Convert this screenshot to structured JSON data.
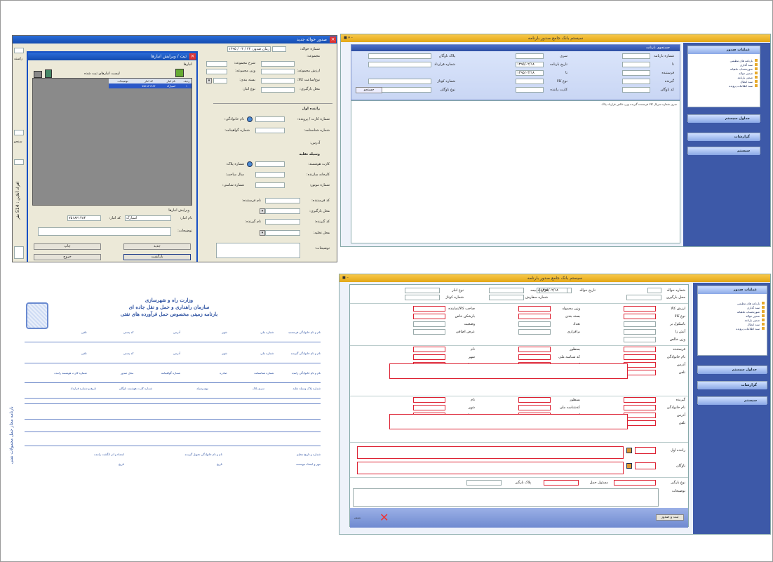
{
  "w1": {
    "title": "صدور حواله جدید",
    "f": {
      "no": "شماره حواله:",
      "date": "زمان صدور: ۲۳ / ۰۳ / ۱۳۹۵",
      "grp": "مجموعه:",
      "desc": "شرح مجموعه:",
      "val": "ارزش مجموعه:",
      "wt": "وزن مجموعه:",
      "pkg": "نوع/ساعت کالا:",
      "pkgtype": "بسته بندی:",
      "load": "محل بارگیری:",
      "tp": "نوع انبار:"
    },
    "r": {
      "head": "راننده اول",
      "card": "شماره کارت / پرونده:",
      "name": "نام خانوادگی:",
      "id": "شماره شناسنامه:",
      "cert": "شماره گواهینامه:",
      "addr": "آدرس:"
    },
    "v": {
      "head": "وسیله نقلیه",
      "card": "کارت هوشمند:",
      "plate": "شماره پلاک:",
      "factory": "کارخانه سازنده:",
      "year": "سال ساخت:",
      "motor": "شماره موتور:",
      "chassis": "شماره شاسی:"
    },
    "b": {
      "sender": "کد فرستنده:",
      "sname": "نام فرستنده:",
      "load": "محل بارگیری:",
      "recv": "کد گیرنده:",
      "rname": "نام گیرنده:",
      "unload": "محل تخلیه:",
      "notes": "توضیحات:"
    },
    "left": {
      "r1": "کد",
      "r2": "راسته",
      "r3": "سنجو"
    }
  },
  "dlg": {
    "title": "ثبت / ویرایش انبارها",
    "grp": "انبارها",
    "list": "لیست انبارهای ثبت شده",
    "cols": [
      "ردیف",
      "نام انبار",
      "کد انبار",
      "توضیحات"
    ],
    "row": [
      "۱",
      "اسپارک",
      "۷۵۱۸۲۱۴۸۴",
      ""
    ],
    "edit": "ویرایش انبارها",
    "nm": "نام انبار:",
    "nmv": "اسپارک",
    "cd": "کد انبار:",
    "cdv": "۷۵۱۸۲۱۴۸۴",
    "desc": "توضیحات:",
    "ba": "جدید",
    "bb": "چاپ",
    "bc": "بازگشت",
    "bd": "خروج",
    "side": "افراد آنلاین : 514 نفر"
  },
  "w2": {
    "title": "سیستم بانک جامع صدور بارنامه",
    "panel": "جستجوی بارنامه",
    "l": [
      "شماره بارنامه",
      "تا",
      "سری",
      "تاریخ بارنامه",
      "تا",
      "پلاک ناوگان",
      "فرستنده",
      "شماره قرارداد",
      "گیرنده",
      "نوع کالا",
      "شماره کوتاژ",
      "کد ناوگان",
      "کارت راننده",
      "نوع ناوگان"
    ],
    "f": [
      "",
      "",
      "",
      "۱۳۹۵/۰۲/۱۸",
      "۱۳۹۵/۰۳/۱۸",
      "",
      "",
      "",
      "",
      "",
      "",
      "",
      "",
      ""
    ],
    "sbtn": "جستجو",
    "cols": "سری  شماره  سریال  کالا  فرستنده  گیرنده  وزن خالص  قرارداد  پلاک",
    "side": {
      "h1": "عملیات صدور",
      "items": [
        "بارنامه های تنظیمی",
        "سند گذاری",
        "صورتحساب ماهیانه",
        "صدور حواله",
        "صدور بارنامه",
        "سند ابطال",
        "سند اطلاعات پرونده"
      ],
      "h2": "جداول سیستم",
      "h3": "گزارشات",
      "h4": "سیستم"
    }
  },
  "doc": {
    "t1": "وزارت راه و شهرسازی",
    "t2": "سازمان راهداری و حمل و نقل جاده ای",
    "t3": "بارنامه زمینی مخصوص حمل فرآورده های نفتی",
    "side": "بارنامه مجاز حمل محمولات نفتی",
    "r1": [
      "نام و نام خانوادگی فرستنده",
      "شماره ملی",
      "شهر",
      "آدرس",
      "کد پستی",
      "تلفن"
    ],
    "r2": [
      "نام و نام خانوادگی گیرنده",
      "شماره ملی",
      "شهر",
      "آدرس",
      "کد پستی",
      "تلفن"
    ],
    "r3": [
      "نام و نام خانوادگی راننده",
      "شماره شناسنامه",
      "صادره",
      "شماره گواهینامه",
      "محل صدور",
      "شماره کارت هوشمند راننده"
    ],
    "r4": [
      "شماره پلاک وسیله نقلیه",
      "سری پلاک",
      "نوع وسیله",
      "شماره کارت هوشمند ناوگان",
      "تاریخ و شماره قرارداد"
    ],
    "bot": [
      "شماره و تاریخ تنظیم",
      "نام و نام خانوادگی تحویل گیرنده",
      "امضاء و اثر انگشت راننده",
      "مهر و امضاء موسسه",
      "تاریخ",
      "تاریخ"
    ]
  },
  "w3": {
    "title": "سیستم بانک جامع صدور بارنامه",
    "top": [
      "شماره حواله",
      "تاریخ حواله",
      "۱۳۹۵/۰۲/۱۸",
      "قرارداد بیمه",
      "نوع انبار",
      "محل بارگیری",
      "شماره سفارش",
      "شماره کوتاژ"
    ],
    "g": [
      "ارزش کالا",
      "وزن محموله",
      "صاحب کالا/نماینده",
      "نوع کالا",
      "بسته بندی",
      "بارشکن خاص",
      "باسکول بر",
      "تعداد",
      "وضعیت",
      "آتش زا",
      "برافزاری",
      "عرض اضافی",
      "وزن خالص"
    ],
    "snd": [
      "فرستنده",
      "بمنظور",
      "نام",
      "نام خانوادگی",
      "کد شناسه ملی",
      "شهر",
      "آدرس",
      "کد پستی",
      "همراه",
      "تلفن",
      "دورنگار",
      "انبار"
    ],
    "rcv": [
      "گیرنده",
      "بمنظور",
      "نام",
      "نام خانوادگی",
      "کدشناسه ملی",
      "شهر",
      "آدرس",
      "کد پستی",
      "همراه",
      "تلفن",
      "دورنگار",
      "انبار"
    ],
    "drv": [
      "راننده اول",
      "ناوگان"
    ],
    "btm": [
      "نوع بارگیر",
      "مسئول حمل",
      "پلاک بارگیر",
      "توضیحات"
    ],
    "save": "ثبت و صدور",
    "close": "بستن",
    "side": {
      "h1": "عملیات صدور",
      "items": [
        "بارنامه های تنظیمی",
        "سند گذاری",
        "صورتحساب ماهیانه",
        "صدور حواله",
        "صدور بارنامه",
        "سند ابطال",
        "سند اطلاعات پرونده"
      ],
      "h2": "جداول سیستم",
      "h3": "گزارشات",
      "h4": "سیستم"
    }
  }
}
